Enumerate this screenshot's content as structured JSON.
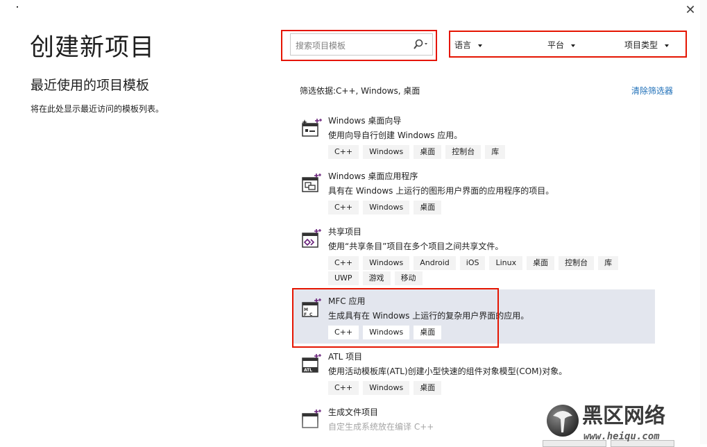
{
  "page": {
    "title": "创建新项目",
    "recent_title": "最近使用的项目模板",
    "recent_desc": "将在此处显示最近访问的模板列表。"
  },
  "search": {
    "placeholder": "搜索项目模板",
    "icon": "search-icon"
  },
  "filters": [
    {
      "label": "语言",
      "icon": "chevron-down-icon"
    },
    {
      "label": "平台",
      "icon": "chevron-down-icon"
    },
    {
      "label": "项目类型",
      "icon": "chevron-down-icon"
    }
  ],
  "filter_info": "筛选依据:C++, Windows, 桌面",
  "clear_filters": "清除筛选器",
  "templates": [
    {
      "name": "Windows 桌面向导",
      "desc": "使用向导自行创建 Windows 应用。",
      "tags": [
        "C++",
        "Windows",
        "桌面",
        "控制台",
        "库"
      ],
      "icon": "windows-desktop-wizard-icon",
      "selected": false
    },
    {
      "name": "Windows 桌面应用程序",
      "desc": "具有在 Windows 上运行的图形用户界面的应用程序的项目。",
      "tags": [
        "C++",
        "Windows",
        "桌面"
      ],
      "icon": "windows-desktop-app-icon",
      "selected": false
    },
    {
      "name": "共享项目",
      "desc": "使用“共享条目”项目在多个项目之间共享文件。",
      "tags": [
        "C++",
        "Windows",
        "Android",
        "iOS",
        "Linux",
        "桌面",
        "控制台",
        "库",
        "UWP",
        "游戏",
        "移动"
      ],
      "icon": "shared-project-icon",
      "selected": false
    },
    {
      "name": "MFC 应用",
      "desc": "生成具有在 Windows 上运行的复杂用户界面的应用。",
      "tags": [
        "C++",
        "Windows",
        "桌面"
      ],
      "icon": "mfc-app-icon",
      "selected": true
    },
    {
      "name": "ATL 项目",
      "desc": "使用活动模板库(ATL)创建小型快速的组件对象模型(COM)对象。",
      "tags": [
        "C++",
        "Windows",
        "桌面"
      ],
      "icon": "atl-project-icon",
      "selected": false
    },
    {
      "name": "生成文件项目",
      "desc": "自定生成系统放在编译 C++",
      "tags": [],
      "icon": "makefile-project-icon",
      "selected": false
    }
  ],
  "watermark": {
    "title": "黑区网络",
    "url": "www.heiqu.com"
  },
  "colors": {
    "highlight": "#e51400",
    "selected_bg": "#e3e6ee",
    "link": "#1e6fb8",
    "accent": "#68217a"
  }
}
